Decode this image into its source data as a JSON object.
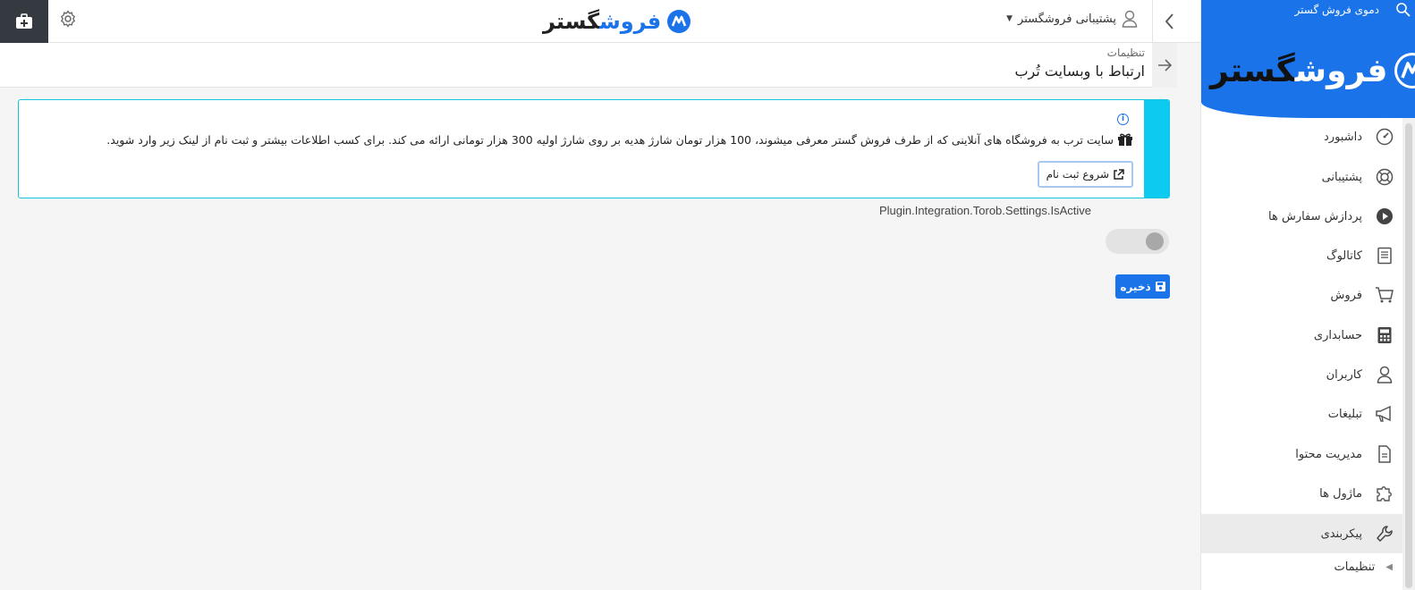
{
  "topbar": {
    "user_label": "پشتیبانی فروشگستر",
    "logo_main": "گستر",
    "logo_accent": "فروش"
  },
  "header": {
    "breadcrumb": "تنظیمات",
    "title": "ارتباط با وبسایت تُرب"
  },
  "info": {
    "text": "سایت ترب به فروشگاه های آنلاینی که از طرف فروش گستر معرفی میشوند، 100 هزار تومان شارژ هدیه بر روی شارژ اولیه 300 هزار تومانی ارائه می کند. برای کسب اطلاعات بیشتر و ثبت نام از لینک زیر وارد شوید.",
    "button_label": "شروع ثبت نام"
  },
  "settings": {
    "is_active_label": "Plugin.Integration.Torob.Settings.IsActive",
    "is_active": false,
    "save_label": "ذخیره"
  },
  "sidebar": {
    "demo_label": "دموی فروش گستر",
    "logo_main": "گستر",
    "logo_accent": "فروش",
    "items": [
      {
        "label": "داشبورد",
        "icon": "dashboard-icon"
      },
      {
        "label": "پشتیبانی",
        "icon": "lifebuoy-icon"
      },
      {
        "label": "پردازش سفارش ها",
        "icon": "play-circle-icon"
      },
      {
        "label": "کاتالوگ",
        "icon": "book-icon"
      },
      {
        "label": "فروش",
        "icon": "cart-icon"
      },
      {
        "label": "حسابداری",
        "icon": "calculator-icon"
      },
      {
        "label": "کاربران",
        "icon": "user-icon"
      },
      {
        "label": "تبلیغات",
        "icon": "megaphone-icon"
      },
      {
        "label": "مدیریت محتوا",
        "icon": "file-icon"
      },
      {
        "label": "ماژول ها",
        "icon": "puzzle-icon"
      },
      {
        "label": "پیکربندی",
        "icon": "wrench-icon"
      }
    ],
    "sub_items": [
      {
        "label": "تنظیمات"
      }
    ]
  },
  "colors": {
    "brand": "#1a73e8",
    "info_stripe": "#0dcaf0",
    "dark_button": "#343a40"
  }
}
